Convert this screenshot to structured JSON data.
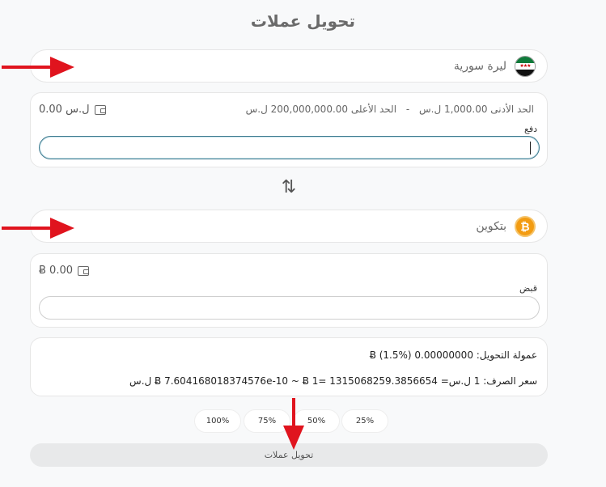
{
  "page": {
    "title": "تحويل عملات"
  },
  "from_currency": {
    "label": "ليرة سورية",
    "icon": "syrian-flag-icon"
  },
  "from_panel": {
    "balance": "0.00 ل.س",
    "min_label": "الحد الأدنى 1,000.00 ل.س",
    "separator": "-",
    "max_label": "الحد الأعلى 200,000,000.00 ل.س",
    "field_label": "دفع",
    "input_value": "",
    "input_placeholder": ""
  },
  "swap_icon": "swap-vertical-icon",
  "to_currency": {
    "label": "بتكوين",
    "icon": "bitcoin-icon",
    "icon_glyph": "₿"
  },
  "to_panel": {
    "balance": "Ƀ 0.00",
    "field_label": "قبض",
    "input_value": "",
    "input_placeholder": ""
  },
  "info": {
    "fee_line": "عمولة التحويل: 0.00000000 Ƀ (1.5%)",
    "rate_line": "سعر الصرف: 1 ل.س= Ƀ 7.604168018374576e-10 ~ Ƀ 1= 1315068259.3856654 ل.س"
  },
  "percent_buttons": [
    "100%",
    "75%",
    "50%",
    "25%"
  ],
  "submit": {
    "label": "تحويل عملات"
  },
  "colors": {
    "accent_arrow": "#e0141e",
    "focus_border": "#3e7a8f",
    "bitcoin": "#f39c12"
  }
}
